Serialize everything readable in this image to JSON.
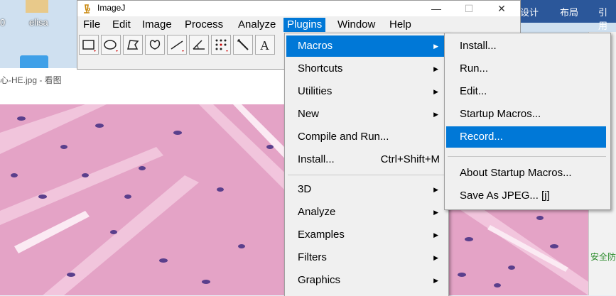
{
  "desktop": {
    "icon_left_label": "0",
    "icon_elisa_label": "elisa"
  },
  "background_app": {
    "tab1": "设计",
    "tab2": "布局",
    "tab3": "引用",
    "side_text": "安全防"
  },
  "viewer": {
    "title": "心-HE.jpg - 看图"
  },
  "imagej": {
    "title": "ImageJ",
    "window_buttons": {
      "minimize": "—",
      "maximize": "☐",
      "close": "✕"
    },
    "menus": [
      "File",
      "Edit",
      "Image",
      "Process",
      "Analyze",
      "Plugins",
      "Window",
      "Help"
    ],
    "active_menu": "Plugins"
  },
  "plugins_menu": {
    "items": [
      {
        "label": "Macros",
        "shortcut": "",
        "submenu": true
      },
      {
        "label": "Shortcuts",
        "shortcut": "",
        "submenu": true
      },
      {
        "label": "Utilities",
        "shortcut": "",
        "submenu": true
      },
      {
        "label": "New",
        "shortcut": "",
        "submenu": true
      },
      {
        "label": "Compile and Run...",
        "shortcut": "",
        "submenu": false
      },
      {
        "label": "Install...",
        "shortcut": "Ctrl+Shift+M",
        "submenu": false
      },
      {
        "label": "3D",
        "shortcut": "",
        "submenu": true
      },
      {
        "label": "Analyze",
        "shortcut": "",
        "submenu": true
      },
      {
        "label": "Examples",
        "shortcut": "",
        "submenu": true
      },
      {
        "label": "Filters",
        "shortcut": "",
        "submenu": true
      },
      {
        "label": "Graphics",
        "shortcut": "",
        "submenu": true
      }
    ]
  },
  "macros_menu": {
    "items": [
      "Install...",
      "Run...",
      "Edit...",
      "Startup Macros...",
      "Record...",
      "About Startup Macros...",
      "Save As JPEG... [j]"
    ]
  },
  "colors": {
    "highlight": "#0078d7",
    "tissue_pink": "#e7a6c8",
    "nuclei": "#5a3f8c"
  }
}
